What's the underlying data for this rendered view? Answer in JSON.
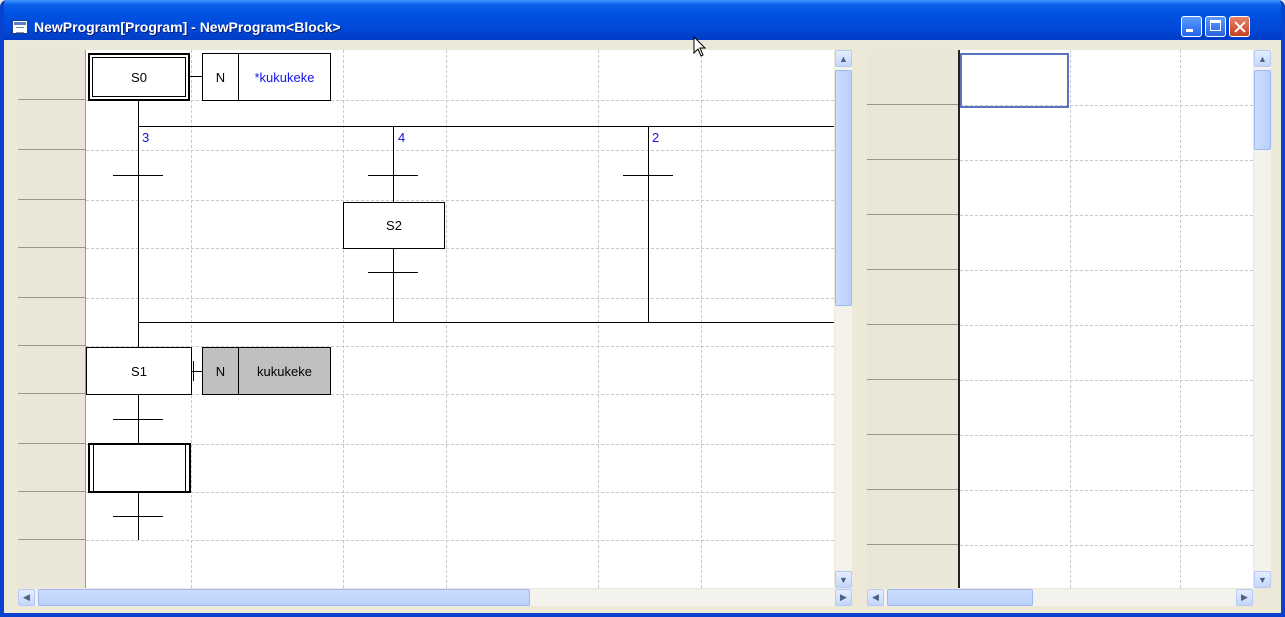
{
  "window": {
    "title": "NewProgram[Program] - NewProgram<Block>",
    "controls": {
      "minimize": "minimize",
      "maximize": "maximize",
      "close": "close"
    },
    "colors": {
      "titlebar": "#0054E3",
      "accent_blue": "#1414E6"
    }
  },
  "sfc": {
    "steps": {
      "s0": "S0",
      "s1": "S1",
      "s2": "S2"
    },
    "action_s0": {
      "qualifier": "N",
      "name": "*kukukeke"
    },
    "action_s1": {
      "qualifier": "N",
      "name": "kukukeke"
    },
    "branch_priorities": [
      "3",
      "4",
      "2"
    ]
  },
  "icons": [
    "window-icon",
    "mouse-cursor-icon",
    "scroll-up-arrow-icon",
    "scroll-down-arrow-icon",
    "scroll-left-arrow-icon",
    "scroll-right-arrow-icon"
  ]
}
